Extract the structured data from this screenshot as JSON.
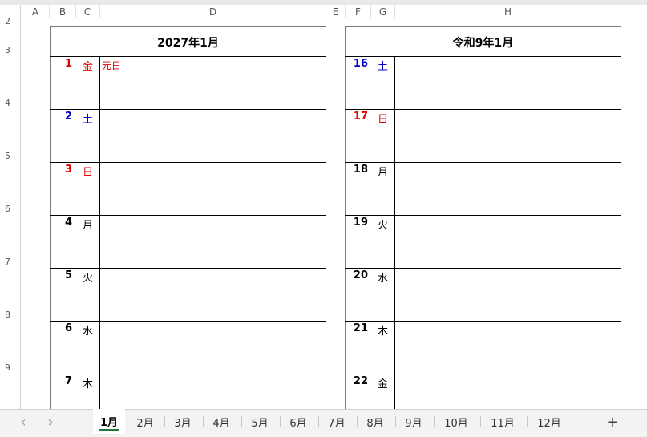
{
  "columns": [
    "A",
    "B",
    "C",
    "D",
    "E",
    "F",
    "G",
    "H"
  ],
  "rows": [
    "2",
    "3",
    "4",
    "5",
    "6",
    "7",
    "8",
    "9"
  ],
  "left_title": "2027年1月",
  "right_title": "令和9年1月",
  "left_days": [
    {
      "num": "1",
      "wd": "金",
      "color": "#e00000",
      "note": "元日"
    },
    {
      "num": "2",
      "wd": "土",
      "color": "#0000cc",
      "note": ""
    },
    {
      "num": "3",
      "wd": "日",
      "color": "#e00000",
      "note": ""
    },
    {
      "num": "4",
      "wd": "月",
      "color": "#000000",
      "note": ""
    },
    {
      "num": "5",
      "wd": "火",
      "color": "#000000",
      "note": ""
    },
    {
      "num": "6",
      "wd": "水",
      "color": "#000000",
      "note": ""
    },
    {
      "num": "7",
      "wd": "木",
      "color": "#000000",
      "note": ""
    }
  ],
  "right_days": [
    {
      "num": "16",
      "wd": "土",
      "color": "#0000cc",
      "note": ""
    },
    {
      "num": "17",
      "wd": "日",
      "color": "#e00000",
      "note": ""
    },
    {
      "num": "18",
      "wd": "月",
      "color": "#000000",
      "note": ""
    },
    {
      "num": "19",
      "wd": "火",
      "color": "#000000",
      "note": ""
    },
    {
      "num": "20",
      "wd": "水",
      "color": "#000000",
      "note": ""
    },
    {
      "num": "21",
      "wd": "木",
      "color": "#000000",
      "note": ""
    },
    {
      "num": "22",
      "wd": "金",
      "color": "#000000",
      "note": ""
    }
  ],
  "tabs": [
    "1月",
    "2月",
    "3月",
    "4月",
    "5月",
    "6月",
    "7月",
    "8月",
    "9月",
    "10月",
    "11月",
    "12月"
  ],
  "active_tab": "1月",
  "nav": {
    "prev": "‹",
    "next": "›",
    "add": "+"
  }
}
